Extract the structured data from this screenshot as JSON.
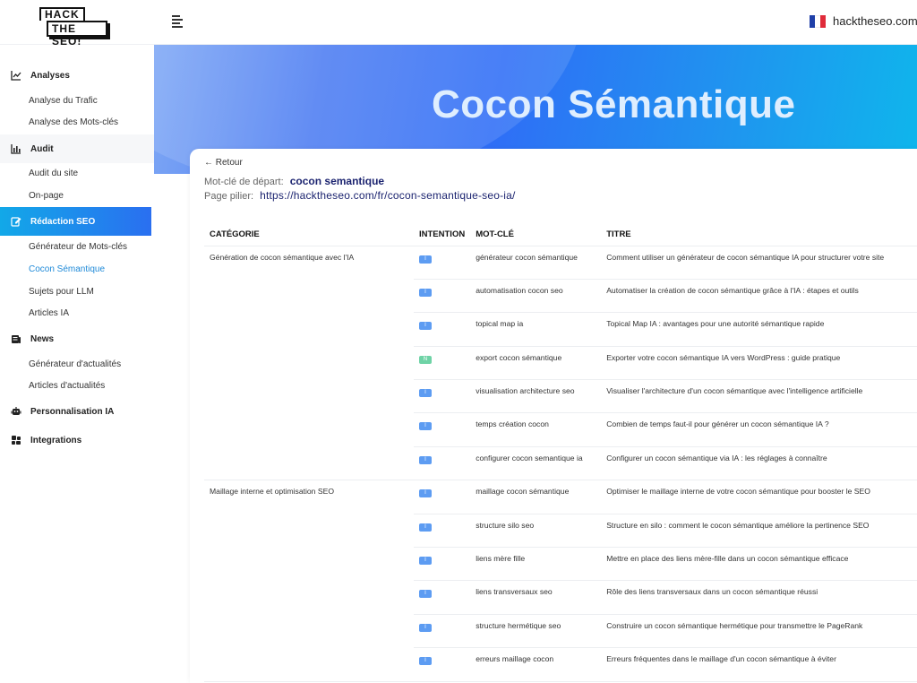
{
  "brand": {
    "logo_line1": "HACK",
    "logo_line2": "THE SEO!",
    "site": "hacktheseo.com",
    "flag_colors": [
      "#1f3fa8",
      "#ffffff",
      "#e02b3a"
    ]
  },
  "sidebar": {
    "sections": [
      {
        "label": "Analyses",
        "icon": "chart-line-icon",
        "items": [
          "Analyse du Trafic",
          "Analyse des Mots-clés"
        ]
      },
      {
        "label": "Audit",
        "icon": "bar-chart-icon",
        "items": [
          "Audit du site",
          "On-page"
        ]
      },
      {
        "label": "Rédaction SEO",
        "icon": "edit-icon",
        "items": [
          "Générateur de Mots-clés",
          "Cocon Sémantique",
          "Sujets pour LLM",
          "Articles IA"
        ]
      },
      {
        "label": "News",
        "icon": "newspaper-icon",
        "items": [
          "Générateur d'actualités",
          "Articles d'actualités"
        ]
      },
      {
        "label": "Personnalisation IA",
        "icon": "robot-icon",
        "items": []
      },
      {
        "label": "Integrations",
        "icon": "integrations-icon",
        "items": []
      }
    ],
    "active_section": "Rédaction SEO",
    "current_item": "Cocon Sémantique",
    "accent": "#1f8ad8"
  },
  "hero": {
    "title": "Cocon Sémantique"
  },
  "content": {
    "back_label": "← Retour",
    "seed_label": "Mot-clé de départ:",
    "seed_value": "cocon semantique",
    "pillar_label": "Page pilier:",
    "pillar_url": "https://hacktheseo.com/fr/cocon-semantique-seo-ia/"
  },
  "table": {
    "headers": [
      "CATÉGORIE",
      "INTENTION",
      "MOT-CLÉ",
      "TITRE"
    ],
    "groups": [
      {
        "category": "Génération de cocon sémantique avec l'IA",
        "rows": [
          {
            "intent": "I",
            "keyword": "générateur cocon sémantique",
            "title": "Comment utiliser un générateur de cocon sémantique IA pour structurer votre site"
          },
          {
            "intent": "I",
            "keyword": "automatisation cocon seo",
            "title": "Automatiser la création de cocon sémantique grâce à l'IA : étapes et outils"
          },
          {
            "intent": "I",
            "keyword": "topical map ia",
            "title": "Topical Map IA : avantages pour une autorité sémantique rapide"
          },
          {
            "intent": "N",
            "keyword": "export cocon sémantique",
            "title": "Exporter votre cocon sémantique IA vers WordPress : guide pratique"
          },
          {
            "intent": "I",
            "keyword": "visualisation architecture seo",
            "title": "Visualiser l'architecture d'un cocon sémantique avec l'intelligence artificielle"
          },
          {
            "intent": "I",
            "keyword": "temps création cocon",
            "title": "Combien de temps faut-il pour générer un cocon sémantique IA ?"
          },
          {
            "intent": "I",
            "keyword": "configurer cocon semantique ia",
            "title": "Configurer un cocon sémantique via IA : les réglages à connaître"
          }
        ]
      },
      {
        "category": "Maillage interne et optimisation SEO",
        "rows": [
          {
            "intent": "I",
            "keyword": "maillage cocon sémantique",
            "title": "Optimiser le maillage interne de votre cocon sémantique pour booster le SEO"
          },
          {
            "intent": "I",
            "keyword": "structure silo seo",
            "title": "Structure en silo : comment le cocon sémantique améliore la pertinence SEO"
          },
          {
            "intent": "I",
            "keyword": "liens mère fille",
            "title": "Mettre en place des liens mère-fille dans un cocon sémantique efficace"
          },
          {
            "intent": "I",
            "keyword": "liens transversaux seo",
            "title": "Rôle des liens transversaux dans un cocon sémantique réussi"
          },
          {
            "intent": "I",
            "keyword": "structure hermétique seo",
            "title": "Construire un cocon sémantique hermétique pour transmettre le PageRank"
          },
          {
            "intent": "I",
            "keyword": "erreurs maillage cocon",
            "title": "Erreurs fréquentes dans le maillage d'un cocon sémantique à éviter"
          }
        ]
      }
    ],
    "intent_colors": {
      "I": "#5d9cf2",
      "N": "#6fd3a6"
    }
  }
}
